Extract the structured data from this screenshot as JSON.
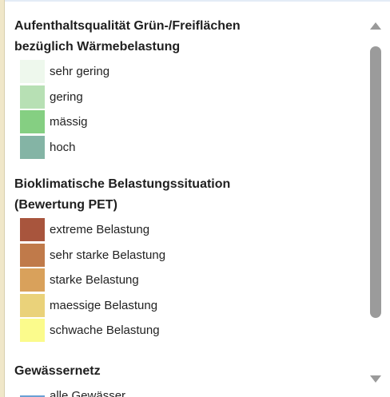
{
  "legend": {
    "sections": [
      {
        "title_line1": "Aufenthaltsqualität Grün-/Freiflächen",
        "title_line2": "bezüglich Wärmebelastung",
        "items": [
          {
            "label": "sehr gering",
            "color": "#eef8ed"
          },
          {
            "label": "gering",
            "color": "#b7e0b4"
          },
          {
            "label": "mässig",
            "color": "#85cf82"
          },
          {
            "label": "hoch",
            "color": "#84b4a5"
          }
        ]
      },
      {
        "title_line1": "Bioklimatische Belastungssituation",
        "title_line2": "(Bewertung PET)",
        "items": [
          {
            "label": "extreme Belastung",
            "color": "#a8553d"
          },
          {
            "label": "sehr starke Belastung",
            "color": "#c07a4a"
          },
          {
            "label": "starke Belastung",
            "color": "#d9a15b"
          },
          {
            "label": "maessige Belastung",
            "color": "#ead27a"
          },
          {
            "label": "schwache Belastung",
            "color": "#fbfb8c"
          }
        ]
      },
      {
        "title_line1": "Gewässernetz",
        "items": [
          {
            "label": "alle Gewässer",
            "color": "#6aa0d4"
          }
        ]
      }
    ]
  },
  "scrollbar": {
    "up_icon": "triangle-up",
    "down_icon": "triangle-down"
  }
}
